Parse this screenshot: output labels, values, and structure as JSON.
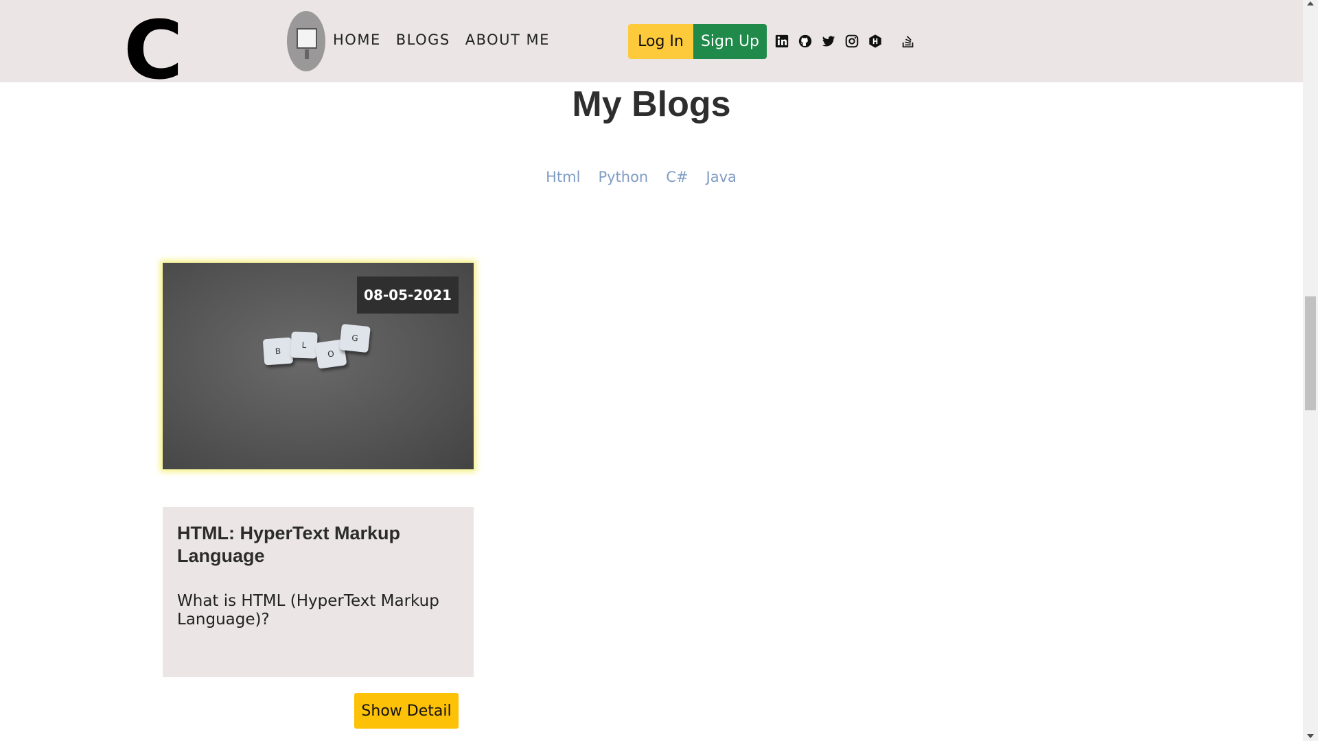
{
  "header": {
    "logo_text": "C",
    "nav": [
      {
        "label": "HOME"
      },
      {
        "label": "BLOGS"
      },
      {
        "label": "ABOUT ME"
      }
    ],
    "login_label": "Log In",
    "signup_label": "Sign Up",
    "socials": [
      "linkedin-icon",
      "github-icon",
      "twitter-icon",
      "instagram-icon",
      "hashnode-icon",
      "stackoverflow-icon"
    ]
  },
  "main": {
    "title": "My Blogs",
    "categories": [
      {
        "label": "Html"
      },
      {
        "label": "Python"
      },
      {
        "label": "C#"
      },
      {
        "label": "Java"
      }
    ],
    "posts": [
      {
        "date": "08-05-2021",
        "image_tiles": [
          "B",
          "L",
          "O",
          "G"
        ],
        "title": "HTML: HyperText Markup Language",
        "description": "What is HTML (HyperText Markup Language)?",
        "button_label": "Show Detail"
      }
    ]
  },
  "colors": {
    "header_bg": "#ebe5e5",
    "login_bg": "#fdca3c",
    "signup_bg": "#1f8a4a",
    "category_link": "#7f9cc4",
    "detail_button": "#fdc107",
    "card_body_bg": "#ebe5e5"
  }
}
